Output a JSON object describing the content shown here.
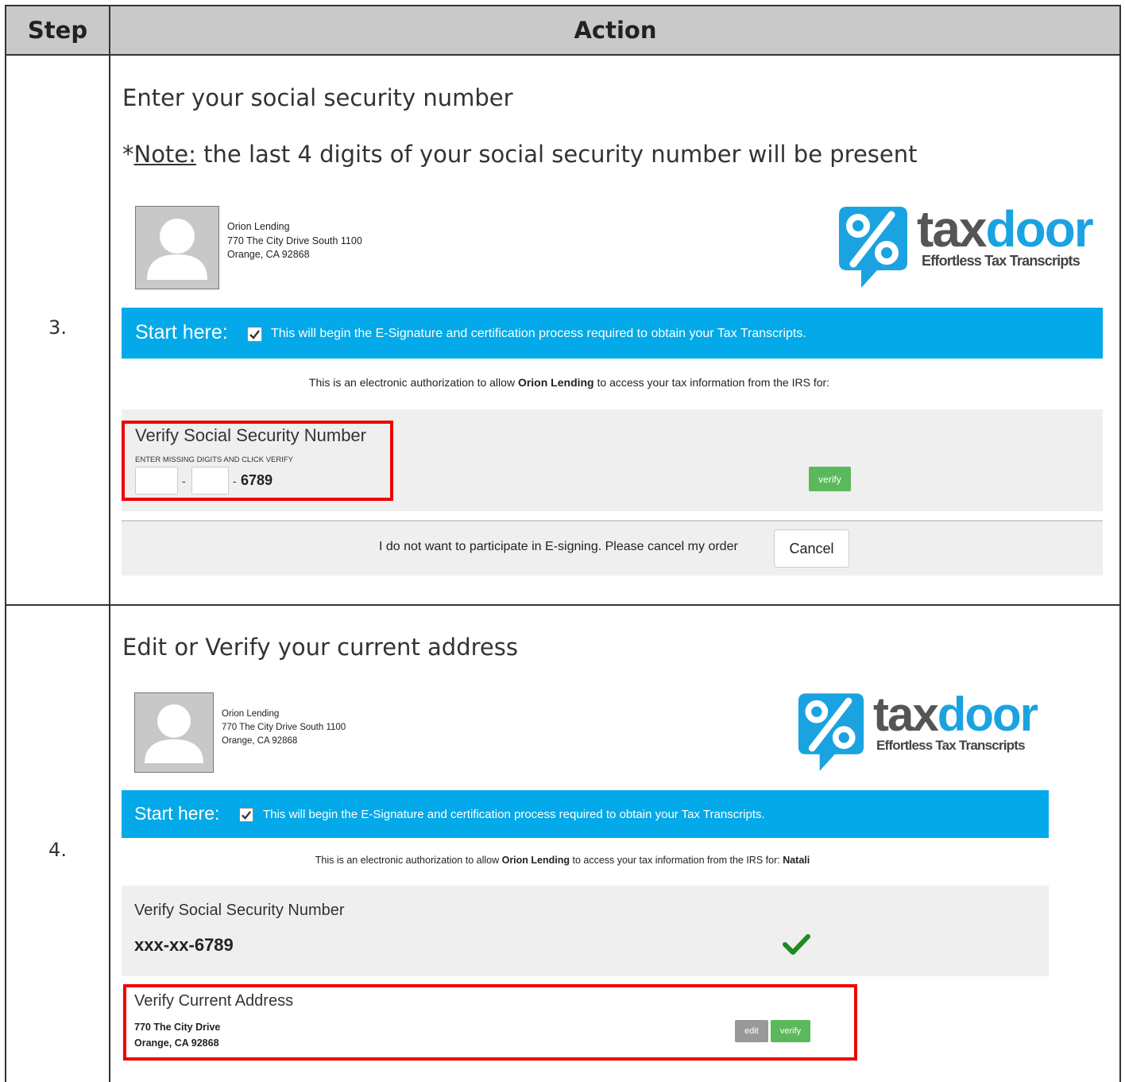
{
  "table": {
    "headers": {
      "step": "Step",
      "action": "Action"
    }
  },
  "rows": [
    {
      "step": "3.",
      "instruction": "Enter your social security number",
      "note_prefix": "*",
      "note_label": "Note:",
      "note_text": " the last 4 digits of your social security number will be present",
      "screen": {
        "lender": {
          "name": "Orion Lending",
          "street": "770 The City Drive South 1100",
          "city": "Orange, CA 92868"
        },
        "logo": {
          "brand_a": "tax",
          "brand_b": "door",
          "tagline": "Effortless Tax Transcripts"
        },
        "start_bar": {
          "label": "Start here:",
          "text": "This will begin the E-Signature and certification process required to obtain your Tax Transcripts."
        },
        "auth": {
          "prefix": "This is an electronic authorization to allow ",
          "lender": "Orion Lending",
          "suffix": " to access your tax information from the IRS for:"
        },
        "ssn": {
          "title": "Verify Social Security Number",
          "hint": "ENTER MISSING DIGITS AND CLICK VERIFY",
          "sep1": "-",
          "sep2": "-",
          "last4": "6789",
          "verify_label": "verify"
        },
        "cancel": {
          "text": "I do not want to participate in E-signing. Please cancel my order",
          "button": "Cancel"
        }
      }
    },
    {
      "step": "4.",
      "instruction": "Edit or Verify your current address",
      "screen": {
        "lender": {
          "name": "Orion Lending",
          "street": "770 The City Drive South 1100",
          "city": "Orange, CA 92868"
        },
        "logo": {
          "brand_a": "tax",
          "brand_b": "door",
          "tagline": "Effortless Tax Transcripts"
        },
        "start_bar": {
          "label": "Start here:",
          "text": "This will begin the E-Signature and certification process required to obtain your Tax Transcripts."
        },
        "auth": {
          "prefix": "This is an electronic authorization to allow ",
          "lender": "Orion Lending",
          "suffix": " to access your tax information from the IRS for: ",
          "name": "Natali"
        },
        "ssn": {
          "title": "Verify Social Security Number",
          "value": "xxx-xx-6789"
        },
        "address": {
          "title": "Verify Current Address",
          "line1": "770 The City Drive",
          "line2": "Orange, CA 92868",
          "edit_label": "edit",
          "verify_label": "verify"
        }
      }
    }
  ],
  "colors": {
    "blue_bar": "#03a9e8",
    "logo_blue": "#1aa3e0",
    "green": "#5cb85c",
    "check_green": "#1f8a1f",
    "highlight_red": "#ee0000",
    "header_gray": "#c9c9c9"
  }
}
